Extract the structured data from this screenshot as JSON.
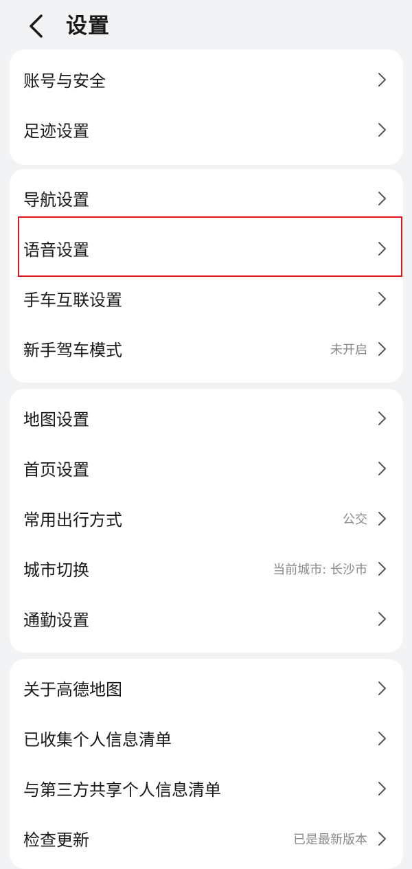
{
  "header": {
    "title": "设置"
  },
  "groups": [
    {
      "items": [
        {
          "label": "账号与安全",
          "value": ""
        },
        {
          "label": "足迹设置",
          "value": ""
        }
      ]
    },
    {
      "items": [
        {
          "label": "导航设置",
          "value": ""
        },
        {
          "label": "语音设置",
          "value": ""
        },
        {
          "label": "手车互联设置",
          "value": ""
        },
        {
          "label": "新手驾车模式",
          "value": "未开启"
        }
      ]
    },
    {
      "items": [
        {
          "label": "地图设置",
          "value": ""
        },
        {
          "label": "首页设置",
          "value": ""
        },
        {
          "label": "常用出行方式",
          "value": "公交"
        },
        {
          "label": "城市切换",
          "value": "当前城市: 长沙市"
        },
        {
          "label": "通勤设置",
          "value": ""
        }
      ]
    },
    {
      "items": [
        {
          "label": "关于高德地图",
          "value": ""
        },
        {
          "label": "已收集个人信息清单",
          "value": ""
        },
        {
          "label": "与第三方共享个人信息清单",
          "value": ""
        },
        {
          "label": "检查更新",
          "value": "已是最新版本"
        }
      ]
    }
  ],
  "colors": {
    "background": "#f1f3f5",
    "card": "#ffffff",
    "highlight_border": "#e0141b",
    "secondary_text": "#8a8a8a"
  },
  "icons": {
    "back": "chevron-left-icon",
    "row_arrow": "chevron-right-icon"
  }
}
